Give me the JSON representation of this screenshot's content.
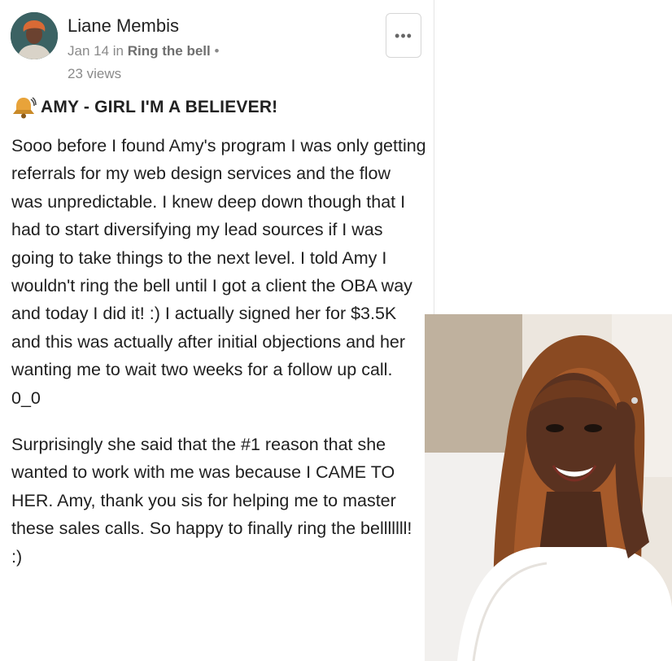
{
  "post": {
    "author": "Liane Membis",
    "date": "Jan 14",
    "in_word": "in",
    "category": "Ring the bell",
    "separator": "•",
    "views": "23 views",
    "more_label": "•••",
    "title": "AMY - GIRL I'M A BELIEVER!",
    "title_icon": "bell-icon",
    "paragraphs": [
      "Sooo before I found Amy's program I was only getting referrals for my web design services and the flow was unpredictable. I knew deep down though that I had to start diversifying my lead sources if I was going to take things to the next level. I told Amy I wouldn't ring the bell until I got a client the OBA way and today I did it! :) I actually signed her for $3.5K and this was actually after initial objections and her wanting me to wait two weeks for a follow up call. 0_0",
      "Surprisingly she said that the #1 reason that she wanted to work with me was because I CAME TO HER. Amy, thank you sis for helping me to master these sales calls. So happy to finally ring the belllllll! :)"
    ]
  },
  "colors": {
    "meta": "#8a8a8a",
    "bell": "#e8a33a",
    "photo_background": "#ece6de"
  }
}
